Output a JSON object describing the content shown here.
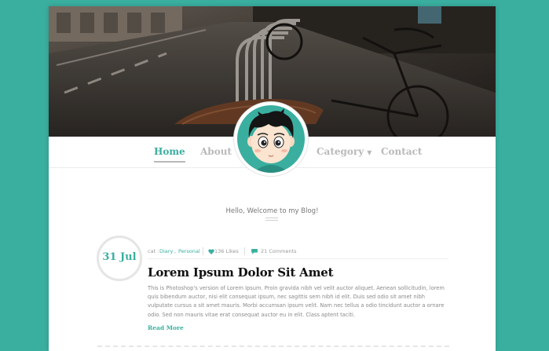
{
  "nav": {
    "items": [
      {
        "label": "Home",
        "active": true
      },
      {
        "label": "About",
        "active": false
      },
      {
        "label": "Category",
        "active": false,
        "dropdown": true
      },
      {
        "label": "Contact",
        "active": false
      }
    ],
    "caret_glyph": "▼"
  },
  "welcome": {
    "text": "Hello, Welcome to my Blog!"
  },
  "post": {
    "date": "31 Jul",
    "meta": {
      "cat_label": "cat :",
      "categories": [
        "Diary",
        "Personal"
      ],
      "category_separator": " , ",
      "likes": "136 Likes",
      "comments": "21 Comments"
    },
    "title": "Lorem Ipsum Dolor Sit Amet",
    "body": "This is Photoshop's version  of Lorem Ipsum. Proin gravida nibh vel velit auctor aliquet. Aenean sollicitudin, lorem quis bibendum auctor, nisi elit consequat ipsum, nec sagittis sem nibh id elit. Duis sed odio sit amet nibh vulputate cursus a sit amet mauris. Morbi accumsan ipsum velit. Nam nec tellus a odio tincidunt auctor a ornare odio. Sed non  mauris vitae erat consequat auctor eu in elit. Class aptent taciti.",
    "read_more": "Read More"
  },
  "colors": {
    "accent": "#3aafa0",
    "nav_inactive": "#b9b9b9",
    "title": "#111111",
    "body_text": "#8a8a8a"
  },
  "icons": {
    "likes": "heart-icon",
    "comments": "comment-icon",
    "dropdown": "caret-down-icon"
  }
}
